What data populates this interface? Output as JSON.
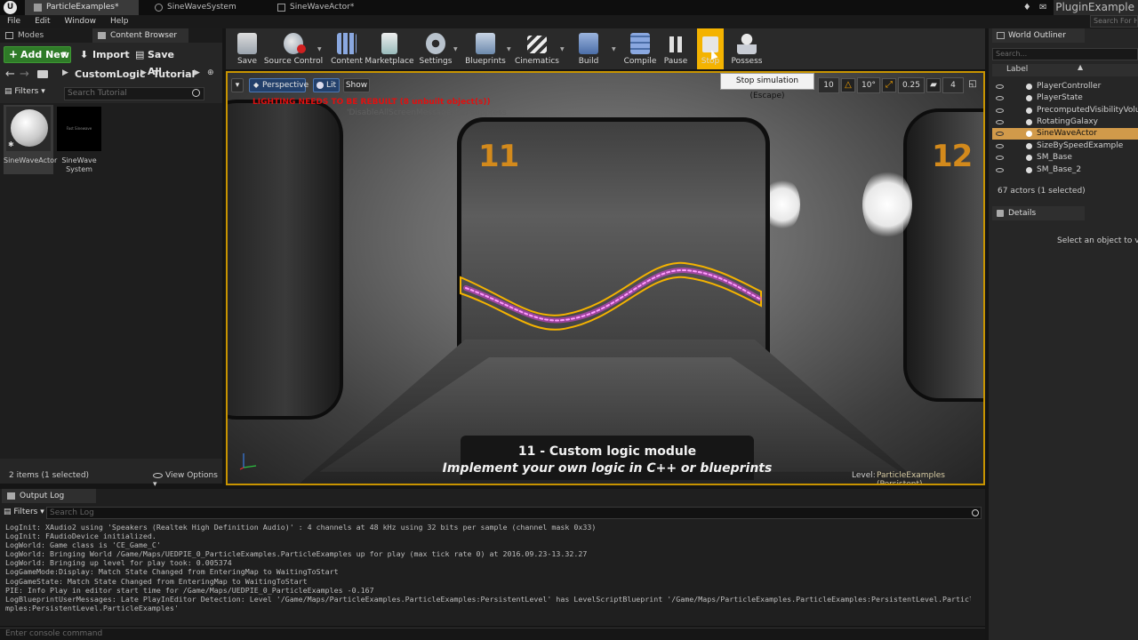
{
  "titlebar": {
    "tabs": [
      "ParticleExamples*",
      "SineWaveSystem",
      "SineWaveActor*"
    ],
    "project": "PluginExample",
    "search_help": "Search For H"
  },
  "menu": [
    "File",
    "Edit",
    "Window",
    "Help"
  ],
  "left_panel": {
    "tabs": [
      "Modes",
      "Content Browser"
    ],
    "add_new": "Add New",
    "import": "Import",
    "save_all": "Save All",
    "breadcrumbs": [
      "CustomLogic",
      "Tutorial"
    ],
    "filters": "Filters",
    "search_placeholder": "Search Tutorial",
    "assets": [
      {
        "label": "SineWaveActor"
      },
      {
        "label": "SineWave System",
        "thumb_text": "Fast Sinewave"
      }
    ],
    "status": "2 items (1 selected)",
    "view_options": "View Options"
  },
  "toolbar": {
    "tools": [
      "Save",
      "Source Control",
      "Content",
      "Marketplace",
      "Settings",
      "Blueprints",
      "Cinematics",
      "Build",
      "Compile",
      "Pause",
      "Stop",
      "Possess"
    ],
    "tooltip": "Stop simulation (Escape)"
  },
  "viewport": {
    "perspective": "Perspective",
    "lit": "Lit",
    "show": "Show",
    "warning": "LIGHTING NEEDS TO BE REBUILT (8 unbuilt object(s))",
    "warning_faded": "'DisableAllScreenMessages' to suppress",
    "snap_grid": "10",
    "snap_rot": "10°",
    "snap_scale": "0.25",
    "cam_speed": "4",
    "sign_left": "11",
    "sign_right": "12",
    "caption_title": "11 - Custom logic module",
    "caption_sub": "Implement your own logic in C++ or blueprints",
    "level_label": "Level:",
    "level_name": "ParticleExamples (Persistent)"
  },
  "outliner": {
    "tab": "World Outliner",
    "search_placeholder": "Search...",
    "column": "Label",
    "rows": [
      {
        "label": "PlayerController",
        "selected": false
      },
      {
        "label": "PlayerState",
        "selected": false
      },
      {
        "label": "PrecomputedVisibilityVolume",
        "selected": false
      },
      {
        "label": "RotatingGalaxy",
        "selected": false
      },
      {
        "label": "SineWaveActor",
        "selected": true
      },
      {
        "label": "SizeBySpeedExample",
        "selected": false
      },
      {
        "label": "SM_Base",
        "selected": false
      },
      {
        "label": "SM_Base_2",
        "selected": false
      }
    ],
    "count": "67 actors (1 selected)"
  },
  "details": {
    "tab": "Details",
    "empty": "Select an object to view details."
  },
  "output_log": {
    "tab": "Output Log",
    "filters": "Filters",
    "search_placeholder": "Search Log",
    "lines": [
      "LogInit: XAudio2 using 'Speakers (Realtek High Definition Audio)' : 4 channels at 48 kHz using 32 bits per sample (channel mask 0x33)",
      "LogInit: FAudioDevice initialized.",
      "LogWorld: Game class is 'CE_Game_C'",
      "LogWorld: Bringing World /Game/Maps/UEDPIE_0_ParticleExamples.ParticleExamples up for play (max tick rate 0) at 2016.09.23-13.32.27",
      "LogWorld: Bringing up level for play took: 0.005374",
      "LogGameMode:Display: Match State Changed from EnteringMap to WaitingToStart",
      "LogGameState: Match State Changed from EnteringMap to WaitingToStart",
      "PIE: Info Play in editor start time for /Game/Maps/UEDPIE_0_ParticleExamples -0.167",
      "LogBlueprintUserMessages: Late PlayInEditor Detection: Level '/Game/Maps/ParticleExamples.ParticleExamples:PersistentLevel' has LevelScriptBlueprint '/Game/Maps/ParticleExamples.ParticleExamples:PersistentLevel.ParticleExamples'",
      "mples:PersistentLevel.ParticleExamples'"
    ],
    "console_placeholder": "Enter console command"
  },
  "colors": {
    "accent": "#f4b300",
    "selection": "#d19a4a",
    "add_new": "#2f7b28",
    "wave": "#e040e0"
  }
}
